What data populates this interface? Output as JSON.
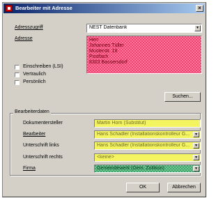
{
  "window": {
    "title": "Bearbeiter mit Adresse",
    "close_glyph": "×"
  },
  "adresszugriff": {
    "label": "Adresszugriff",
    "value": "NEST Datenbank"
  },
  "adresse": {
    "label": "Adresse",
    "lines": [
      "Herr",
      "Johannes Tüller",
      "Musterstr. 18",
      "Postfach",
      "8303 Bassersdorf"
    ]
  },
  "checkboxes": [
    {
      "label": "Einschreiben (LSI)",
      "checked": false
    },
    {
      "label": "Vertraulich",
      "checked": false
    },
    {
      "label": "Persönlich",
      "checked": false
    }
  ],
  "suchen_button": "Suchen...",
  "bearbeiterdaten": {
    "title": "Bearbeiterdaten",
    "fields": [
      {
        "label": "Dokumentersteller",
        "value": "Martin Horn (Substitut)",
        "dropdown": false,
        "color": "yellow"
      },
      {
        "label": "Bearbeiter",
        "value": "Hans Schadler (Installationskontrolleur G...",
        "dropdown": true,
        "color": "yellow"
      },
      {
        "label": "Unterschrift links",
        "value": "Hans Schadler (Installationskontrolleur G...",
        "dropdown": true,
        "color": "yellow"
      },
      {
        "label": "Unterschrift rechts",
        "value": "<keine>",
        "dropdown": true,
        "color": "yellow"
      },
      {
        "label": "Firma",
        "value": "Gemeindewerk (Gem. Zollikon)",
        "dropdown": true,
        "color": "green"
      }
    ]
  },
  "buttons": {
    "ok": "OK",
    "cancel": "Abbrechen"
  },
  "colors": {
    "title_start": "#0a246a",
    "title_end": "#a6caf0",
    "address_bg": "#ff3b6e",
    "field_yellow": "#f4f460",
    "field_green": "#3ca86a",
    "dialog_bg": "#d4d0c8"
  }
}
